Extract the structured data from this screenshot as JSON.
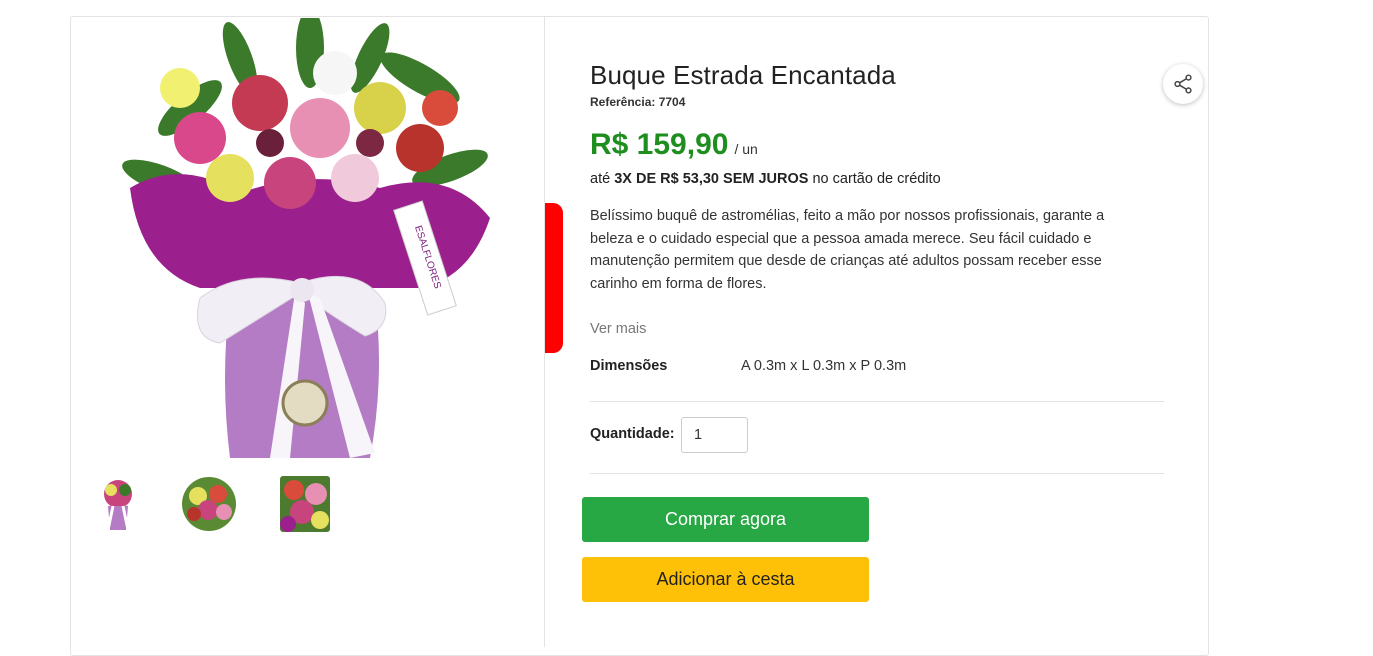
{
  "product": {
    "title": "Buque Estrada Encantada",
    "reference": "Referência: 7704",
    "price": "R$ 159,90",
    "unit": "/ un",
    "installments_prefix": "até",
    "installments_bold": "3X DE R$ 53,30 SEM JUROS",
    "installments_suffix": "no cartão de crédito",
    "description": "Belíssimo buquê de astromélias, feito a mão por nossos profissionais, garante a beleza e o cuidado especial que a pessoa amada merece. Seu fácil cuidado e manutenção permitem que desde de crianças até adultos possam receber esse carinho em forma de flores.",
    "see_more": "Ver mais",
    "dimensions_label": "Dimensões",
    "dimensions_value": "A 0.3m x L 0.3m x P 0.3m",
    "tag_text": "ESALFLORES"
  },
  "quantity": {
    "label": "Quantidade:",
    "value": "1"
  },
  "actions": {
    "buy_now": "Comprar agora",
    "add_to_cart": "Adicionar à cesta"
  },
  "icons": {
    "share": "share-icon"
  },
  "colors": {
    "price": "#1e8e1e",
    "buy_button": "#28a745",
    "cart_button": "#ffc107",
    "marker": "#ff0000"
  }
}
